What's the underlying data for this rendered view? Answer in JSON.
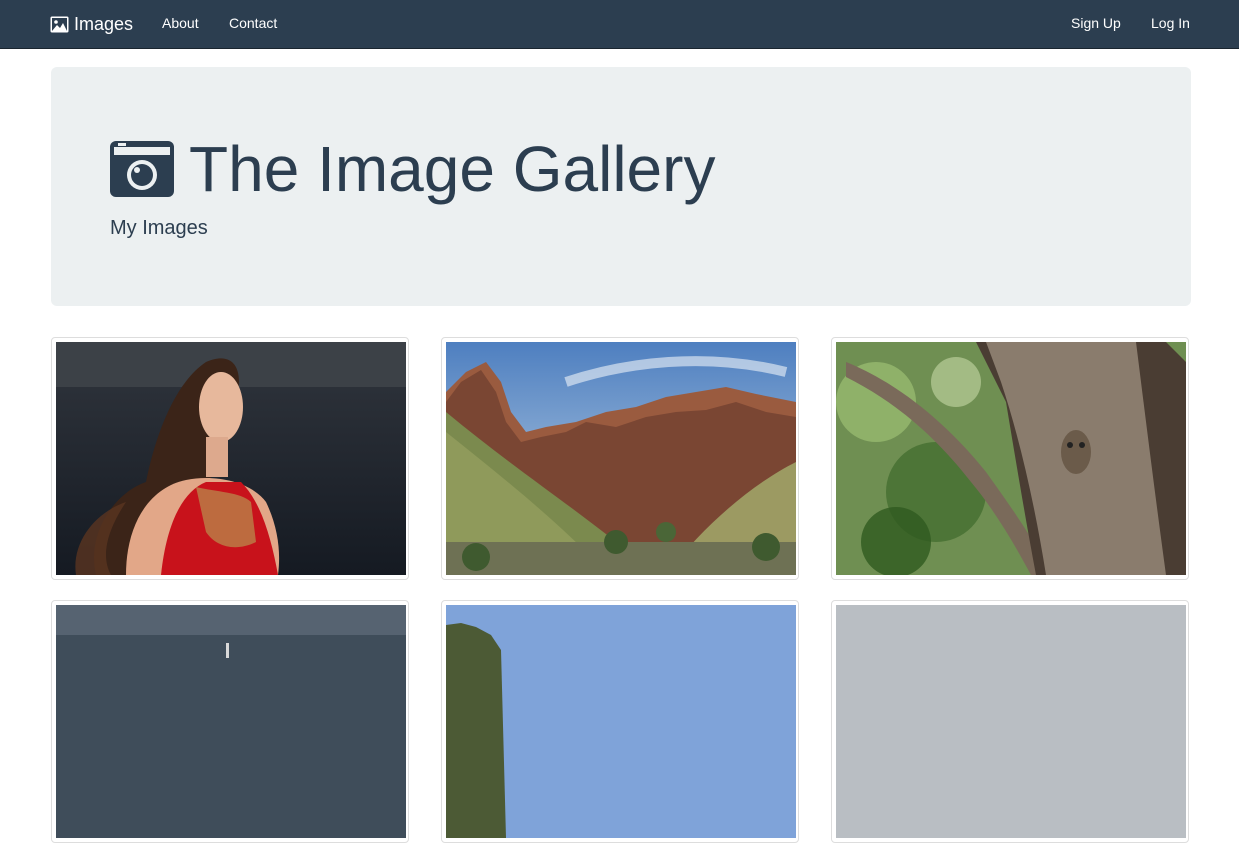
{
  "navbar": {
    "brand_label": "Images",
    "left_links": [
      "About",
      "Contact"
    ],
    "right_links": [
      "Sign Up",
      "Log In"
    ]
  },
  "jumbotron": {
    "title": "The Image Gallery",
    "subtitle": "My Images"
  },
  "gallery": {
    "images": [
      {
        "subject": "woman in red dress by the sea"
      },
      {
        "subject": "red rock canyon mountains"
      },
      {
        "subject": "owl in tree trunk"
      },
      {
        "subject": "sky with lighthouse"
      },
      {
        "subject": "blue sky with rocky hill"
      },
      {
        "subject": "grey sky"
      }
    ]
  },
  "colors": {
    "navbar": "#2c3e50",
    "jumbotron": "#ecf0f1",
    "text": "#2c3e50"
  }
}
